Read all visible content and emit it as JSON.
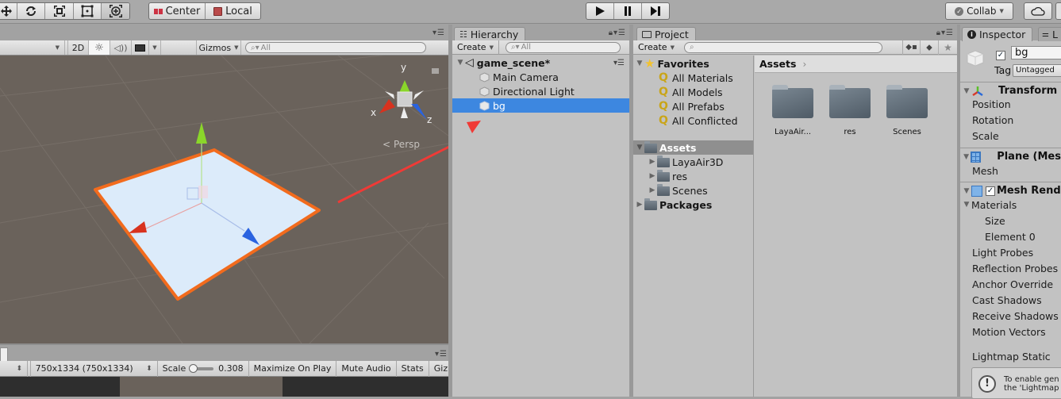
{
  "toolbar": {
    "tools": [
      {
        "name": "move-tool",
        "icon": "move-icon"
      },
      {
        "name": "rotate-tool",
        "icon": "rotate-icon"
      },
      {
        "name": "scale-tool",
        "icon": "scale-icon"
      },
      {
        "name": "rect-tool",
        "icon": "rect-icon"
      },
      {
        "name": "transform-tool",
        "icon": "transform-icon"
      }
    ],
    "pivot_label": "Center",
    "space_label": "Local",
    "play_icon": "play-icon",
    "pause_icon": "pause-icon",
    "step_icon": "step-icon",
    "collab_label": "Collab",
    "cloud_icon": "cloud-icon"
  },
  "scene": {
    "toolbar": {
      "mode_2d": "2D",
      "gizmos_label": "Gizmos",
      "search_placeholder": "All"
    },
    "gizmo": {
      "x_label": "x",
      "y_label": "y",
      "z_label": "z",
      "persp_label": "Persp"
    },
    "colors": {
      "background": "#6a625b",
      "selection_outline": "#f26b1d",
      "plane": "#dcebfa",
      "x_axis": "#d8321e",
      "y_axis": "#8ad62a",
      "z_axis": "#2a63e0",
      "annotation_arrow": "#f03a36"
    }
  },
  "game": {
    "aspect_value": "750x1334 (750x1334)",
    "scale_label": "Scale",
    "scale_value": "0.308",
    "scale_fraction": 0.05,
    "maximize_label": "Maximize On Play",
    "mute_label": "Mute Audio",
    "stats_label": "Stats",
    "gizmos_label": "Gizmos"
  },
  "hierarchy": {
    "tab_label": "Hierarchy",
    "create_label": "Create",
    "search_placeholder": "All",
    "scene_name": "game_scene*",
    "items": [
      {
        "label": "Main Camera",
        "selected": false
      },
      {
        "label": "Directional Light",
        "selected": false
      },
      {
        "label": "bg",
        "selected": true
      }
    ],
    "selection_color": "#3d87e0"
  },
  "project": {
    "tab_label": "Project",
    "create_label": "Create",
    "search_placeholder": "",
    "favorites_label": "Favorites",
    "favorites": [
      "All Materials",
      "All Models",
      "All Prefabs",
      "All Conflicted"
    ],
    "assets_label": "Assets",
    "asset_folders": [
      "LayaAir3D",
      "res",
      "Scenes"
    ],
    "packages_label": "Packages",
    "breadcrumb": "Assets",
    "grid_items": [
      "LayaAir...",
      "res",
      "Scenes"
    ]
  },
  "inspector": {
    "tab_label": "Inspector",
    "second_tab_label": "L",
    "object_name": "bg",
    "object_active": true,
    "tag_label": "Tag",
    "tag_value": "Untagged",
    "transform": {
      "title": "Transform",
      "fields": [
        "Position",
        "Rotation",
        "Scale"
      ]
    },
    "mesh_filter": {
      "title": "Plane (Mes",
      "field": "Mesh"
    },
    "mesh_renderer": {
      "title": "Mesh Rend",
      "enabled": true,
      "materials_label": "Materials",
      "size_label": "Size",
      "element0_label": "Element 0",
      "fields": [
        "Light Probes",
        "Reflection Probes",
        "Anchor Override",
        "Cast Shadows",
        "Receive Shadows",
        "Motion Vectors"
      ],
      "lightmap_static": "Lightmap Static",
      "info_line1": "To enable gen",
      "info_line2": "the 'Lightmap"
    }
  }
}
